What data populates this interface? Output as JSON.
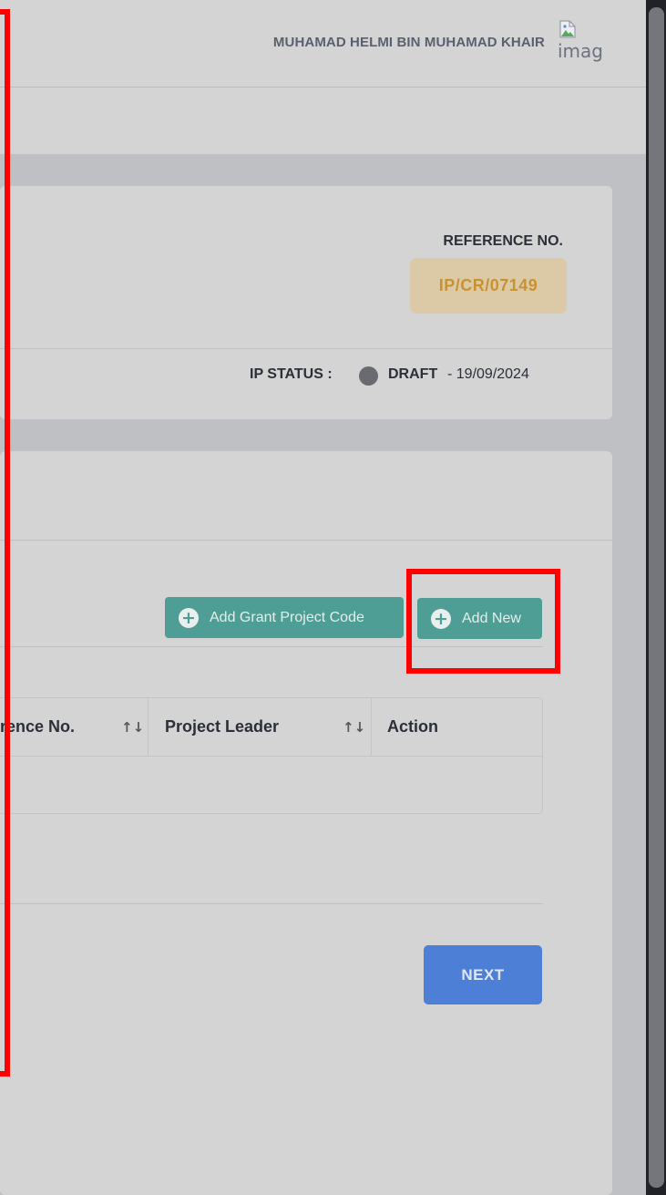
{
  "header": {
    "username": "MUHAMAD HELMI BIN MUHAMAD KHAIR",
    "avatar_alt": "imag"
  },
  "reference": {
    "label": "REFERENCE NO.",
    "value": "IP/CR/07149"
  },
  "status": {
    "label": "IP STATUS :",
    "value": "DRAFT",
    "date": "- 19/09/2024"
  },
  "actions": {
    "add_grant_label": "Add Grant Project Code",
    "add_new_label": "Add New",
    "plus_icon": "+"
  },
  "table": {
    "columns": [
      {
        "label": "rence No.",
        "sortable": true
      },
      {
        "label": "Project Leader",
        "sortable": true
      },
      {
        "label": "Action",
        "sortable": false
      }
    ],
    "sort_glyph": "↑↓",
    "rows": []
  },
  "footer": {
    "next_label": "NEXT"
  },
  "colors": {
    "accent_green": "#4f9e95",
    "next_blue": "#4d7fd7",
    "ref_gold": "#c89232",
    "highlight_red": "#ff0000"
  }
}
